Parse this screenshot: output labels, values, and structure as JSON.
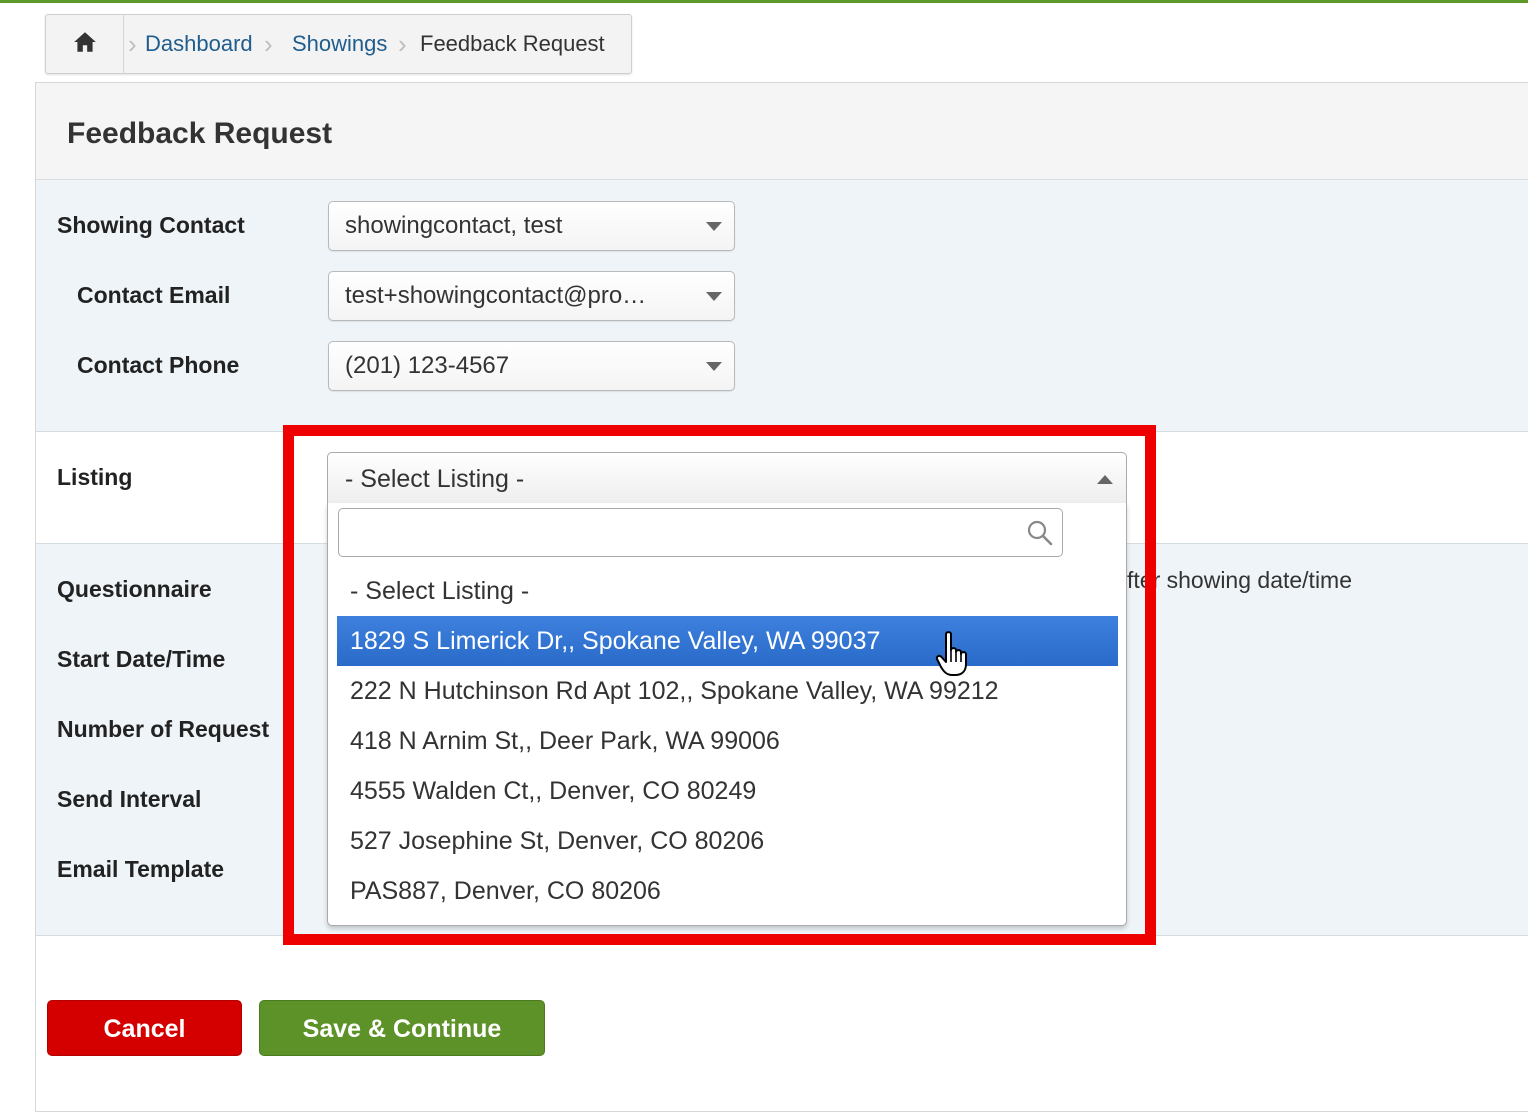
{
  "breadcrumb": {
    "home_icon": "home-icon",
    "items": [
      "Dashboard",
      "Showings",
      "Feedback Request"
    ]
  },
  "panel": {
    "title": "Feedback Request"
  },
  "form": {
    "showing_contact": {
      "label": "Showing Contact",
      "value": "showingcontact, test"
    },
    "contact_email": {
      "label": "Contact Email",
      "value": "test+showingcontact@pro…"
    },
    "contact_phone": {
      "label": "Contact Phone",
      "value": "(201) 123-4567"
    },
    "listing": {
      "label": "Listing",
      "value": "- Select Listing -",
      "search_placeholder": "",
      "options": [
        "- Select Listing -",
        "1829 S Limerick Dr,, Spokane Valley, WA 99037",
        "222 N Hutchinson Rd Apt 102,, Spokane Valley, WA 99212",
        "418 N Arnim St,, Deer Park, WA 99006",
        "4555 Walden Ct,, Denver, CO 80249",
        "527 Josephine St, Denver, CO 80206",
        "PAS887, Denver, CO 80206"
      ],
      "highlighted_index": 1
    },
    "questionnaire": {
      "label": "Questionnaire"
    },
    "start_datetime": {
      "label": "Start Date/Time",
      "partial_text": "fter showing date/time"
    },
    "number_of_request": {
      "label": "Number of Request"
    },
    "send_interval": {
      "label": "Send Interval"
    },
    "email_template": {
      "label": "Email Template"
    }
  },
  "buttons": {
    "cancel": "Cancel",
    "save_continue": "Save & Continue"
  },
  "colors": {
    "top_accent": "#5e9a2a",
    "highlight_border": "#ee0000",
    "selected_option": "#3875d7",
    "cancel_button": "#d40000",
    "save_button": "#5d9228",
    "link": "#1f5d8e"
  }
}
